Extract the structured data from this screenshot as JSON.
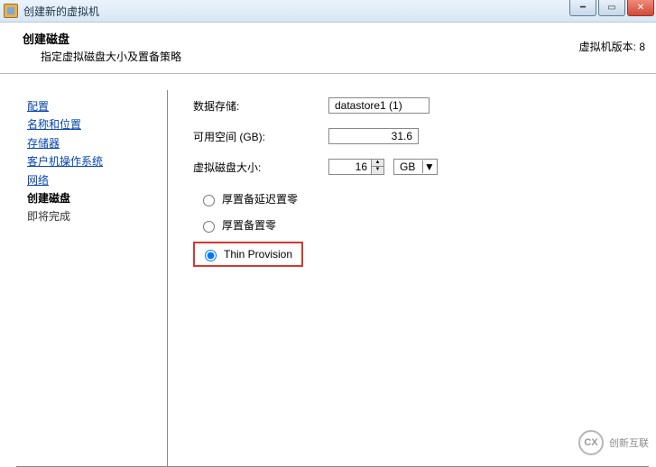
{
  "window": {
    "title": "创建新的虚拟机"
  },
  "header": {
    "title": "创建磁盘",
    "subtitle": "指定虚拟磁盘大小及置备策略",
    "version": "虚拟机版本: 8"
  },
  "sidebar": {
    "items": [
      {
        "label": "配置",
        "type": "link"
      },
      {
        "label": "名称和位置",
        "type": "link"
      },
      {
        "label": "存储器",
        "type": "link"
      },
      {
        "label": "客户机操作系统",
        "type": "link"
      },
      {
        "label": "网络",
        "type": "link"
      },
      {
        "label": "创建磁盘",
        "type": "current"
      },
      {
        "label": "即将完成",
        "type": "plain"
      }
    ]
  },
  "form": {
    "datastore_label": "数据存储:",
    "datastore_value": "datastore1 (1)",
    "freespace_label": "可用空间 (GB):",
    "freespace_value": "31.6",
    "disksize_label": "虚拟磁盘大小:",
    "disksize_value": "16",
    "disksize_unit": "GB",
    "radios": {
      "thick_lazy": "厚置备延迟置零",
      "thick_eager": "厚置备置零",
      "thin": "Thin Provision"
    }
  },
  "watermark": {
    "logo": "CX",
    "text": "创新互联"
  }
}
